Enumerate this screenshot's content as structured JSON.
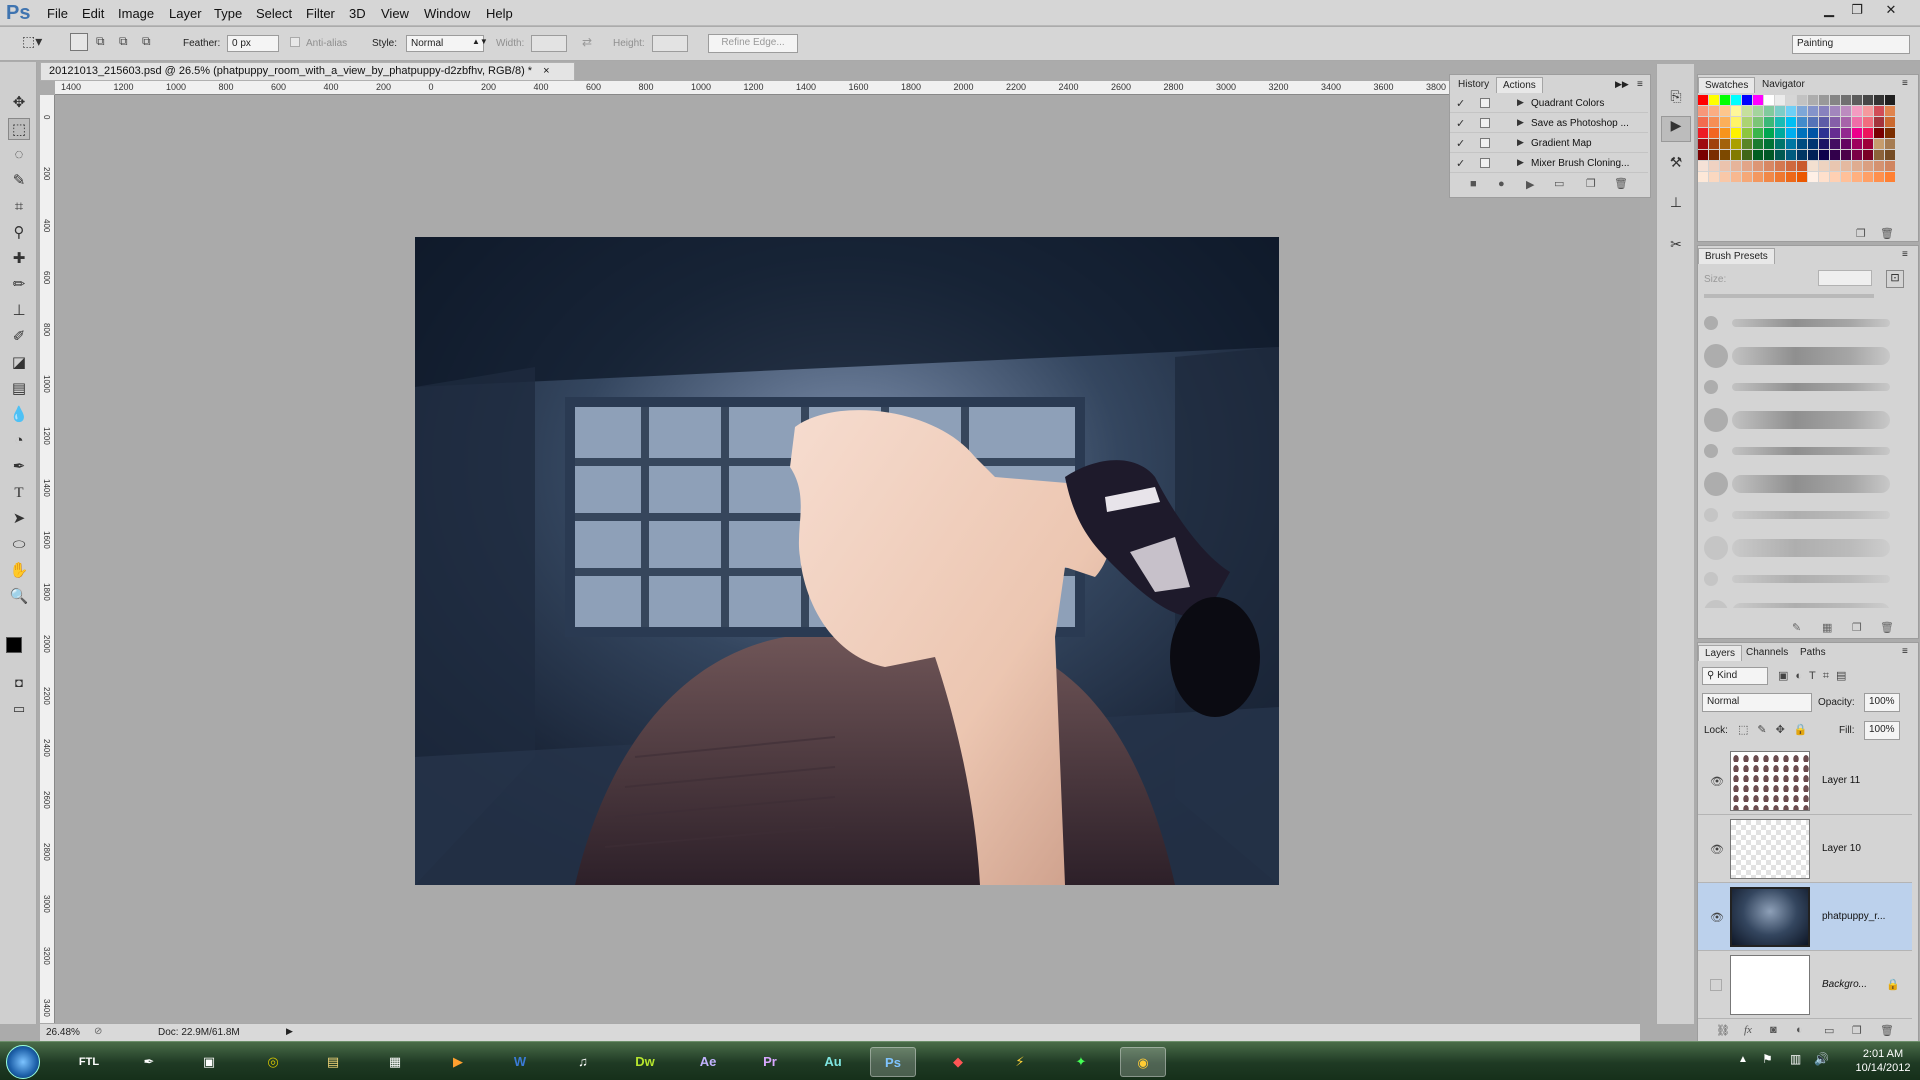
{
  "app": {
    "logo": "Ps"
  },
  "menu": [
    "File",
    "Edit",
    "Image",
    "Layer",
    "Type",
    "Select",
    "Filter",
    "3D",
    "View",
    "Window",
    "Help"
  ],
  "options": {
    "feather_label": "Feather:",
    "feather_value": "0 px",
    "antialias_label": "Anti-alias",
    "style_label": "Style:",
    "style_value": "Normal",
    "width_label": "Width:",
    "height_label": "Height:",
    "refine_label": "Refine Edge...",
    "workspace": "Painting"
  },
  "document": {
    "tab_title": "20121013_215603.psd @ 26.5% (phatpuppy_room_with_a_view_by_phatpuppy-d2zbfhv, RGB/8) *",
    "close": "×",
    "ruler_ticks": [
      "1400",
      "1200",
      "1000",
      "800",
      "600",
      "400",
      "200",
      "0",
      "200",
      "400",
      "600",
      "800",
      "1000",
      "1200",
      "1400",
      "1600",
      "1800",
      "2000",
      "2200",
      "2400",
      "2600",
      "2800",
      "3000",
      "3200",
      "3400",
      "3600",
      "3800"
    ],
    "vruler_ticks": [
      "0",
      "200",
      "400",
      "600",
      "800",
      "1000",
      "1200",
      "1400",
      "1600",
      "1800",
      "2000",
      "2200",
      "2400",
      "2600",
      "2800",
      "3000",
      "3200",
      "3400"
    ]
  },
  "status": {
    "zoom": "26.48%",
    "doc": "Doc: 22.9M/61.8M"
  },
  "history_panel": {
    "tabs": [
      "History",
      "Actions"
    ],
    "actions": [
      {
        "name": "Quadrant Colors",
        "checked": "✓"
      },
      {
        "name": "Save as Photoshop ...",
        "checked": "✓"
      },
      {
        "name": "Gradient Map",
        "checked": "✓"
      },
      {
        "name": "Mixer Brush Cloning...",
        "checked": "✓"
      }
    ]
  },
  "swatches_panel": {
    "tabs": [
      "Swatches",
      "Navigator"
    ]
  },
  "brush_panel": {
    "title": "Brush Presets",
    "size_label": "Size:"
  },
  "layers_panel": {
    "tabs": [
      "Layers",
      "Channels",
      "Paths"
    ],
    "filter": "Kind",
    "blend_mode": "Normal",
    "opacity_label": "Opacity:",
    "opacity": "100%",
    "lock_label": "Lock:",
    "fill_label": "Fill:",
    "fill": "100%",
    "layers": [
      {
        "name": "Layer 11",
        "visible": "👁"
      },
      {
        "name": "Layer 10",
        "visible": "👁"
      },
      {
        "name": "phatpuppy_r...",
        "visible": "👁"
      },
      {
        "name": "Backgro...",
        "visible": ""
      }
    ]
  },
  "taskbar": {
    "apps": [
      "FTL",
      "Dw",
      "Ae",
      "Pr",
      "Au",
      "Ps"
    ],
    "time": "2:01 AM",
    "date": "10/14/2012"
  }
}
